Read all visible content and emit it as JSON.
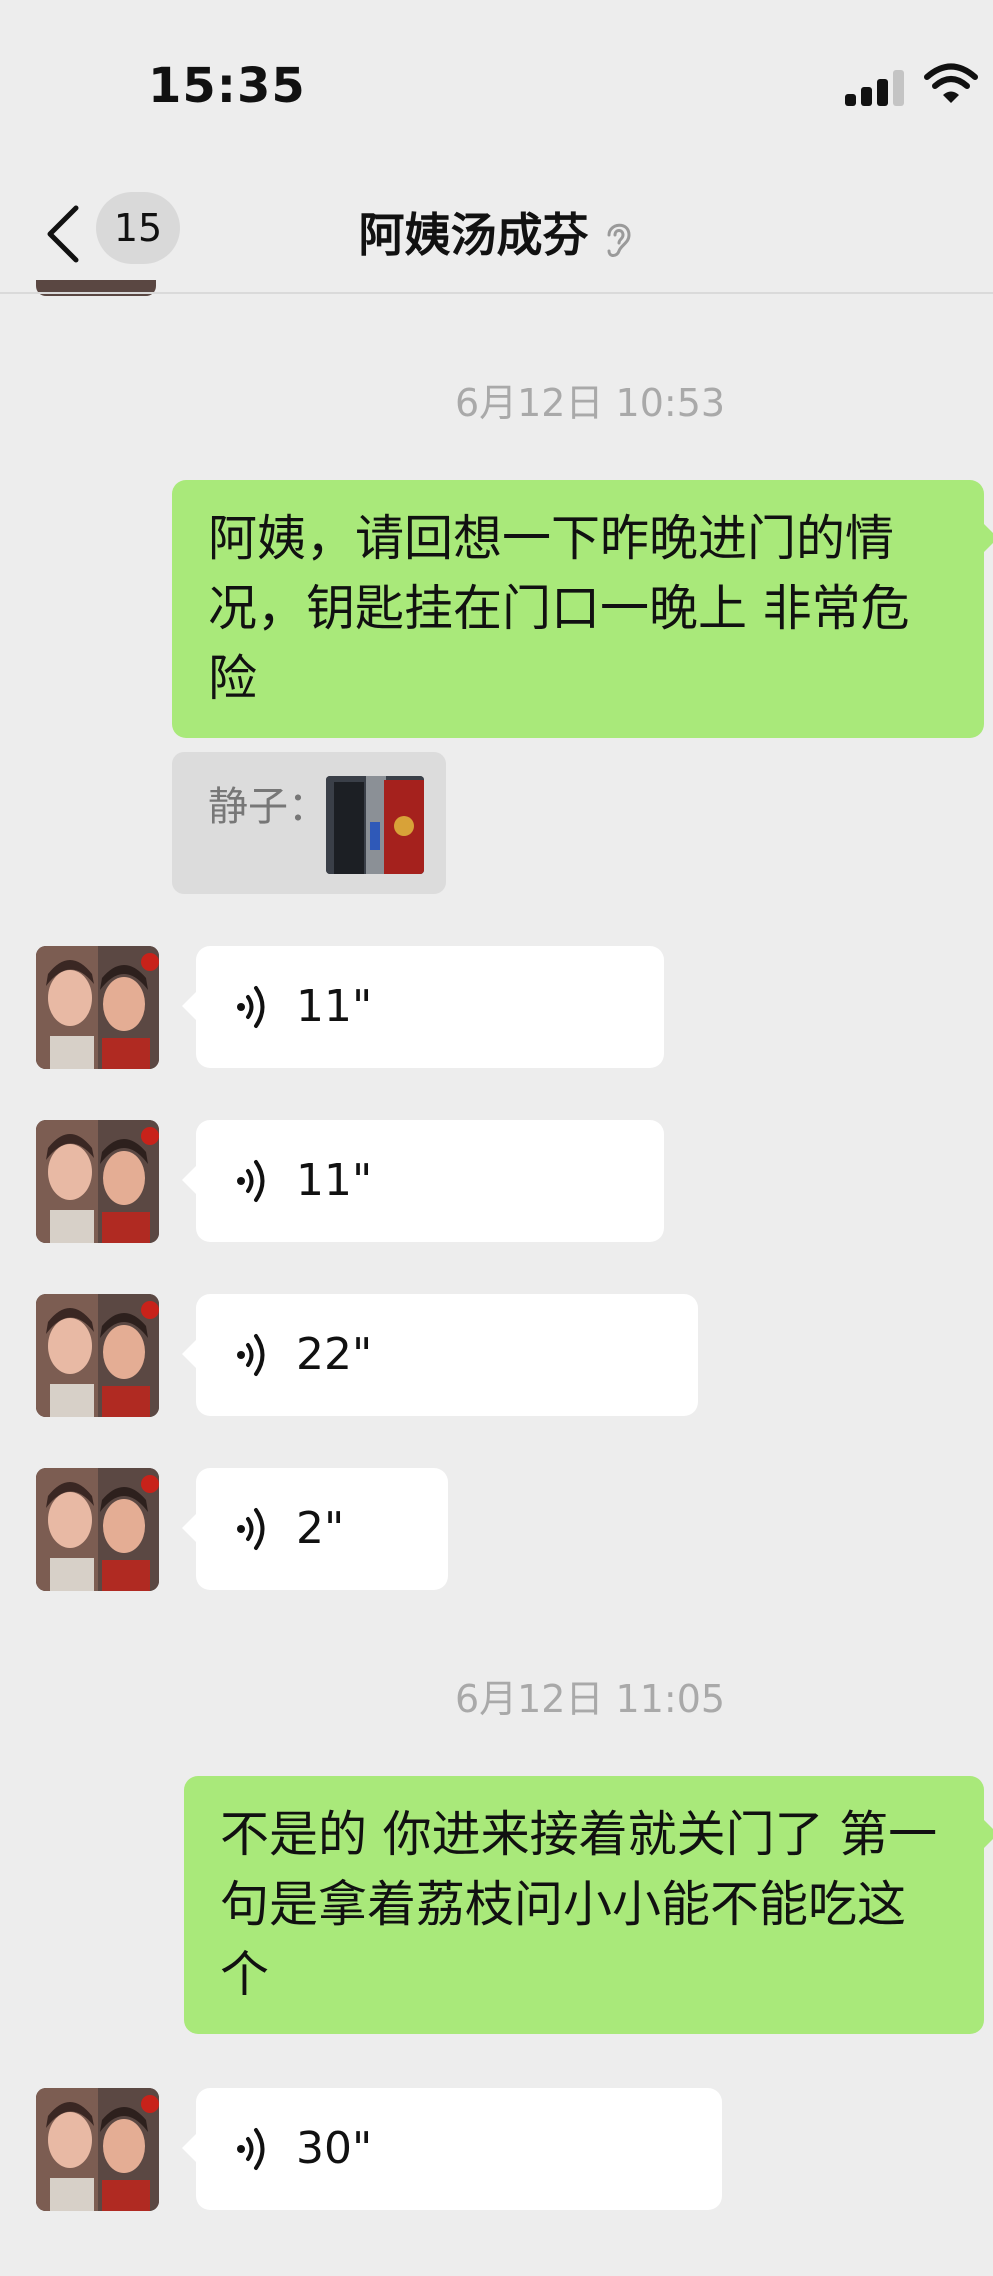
{
  "status_bar": {
    "time": "15:35"
  },
  "header": {
    "back_label": "<",
    "unread_count": "15",
    "title": "阿姨汤成芬"
  },
  "messages": {
    "stamp1": "6月12日 10:53",
    "out1": "阿姨，请回想一下昨晚进门的情况，钥匙挂在门口一晚上 非常危险",
    "quote_label": "静子：",
    "voice1": "11\"",
    "voice2": "11\"",
    "voice3": "22\"",
    "voice4": "2\"",
    "stamp2": "6月12日 11:05",
    "out2": "不是的 你进来接着就关门了 第一句是拿着荔枝问小小能不能吃这个",
    "voice5": "30\""
  },
  "colors": {
    "outgoing_bubble": "#a9e97a",
    "incoming_bubble": "#ffffff",
    "background": "#ededed"
  },
  "icons": [
    "chevron-left-icon",
    "ear-icon",
    "voice-wave-icon",
    "signal-icon",
    "wifi-icon"
  ]
}
